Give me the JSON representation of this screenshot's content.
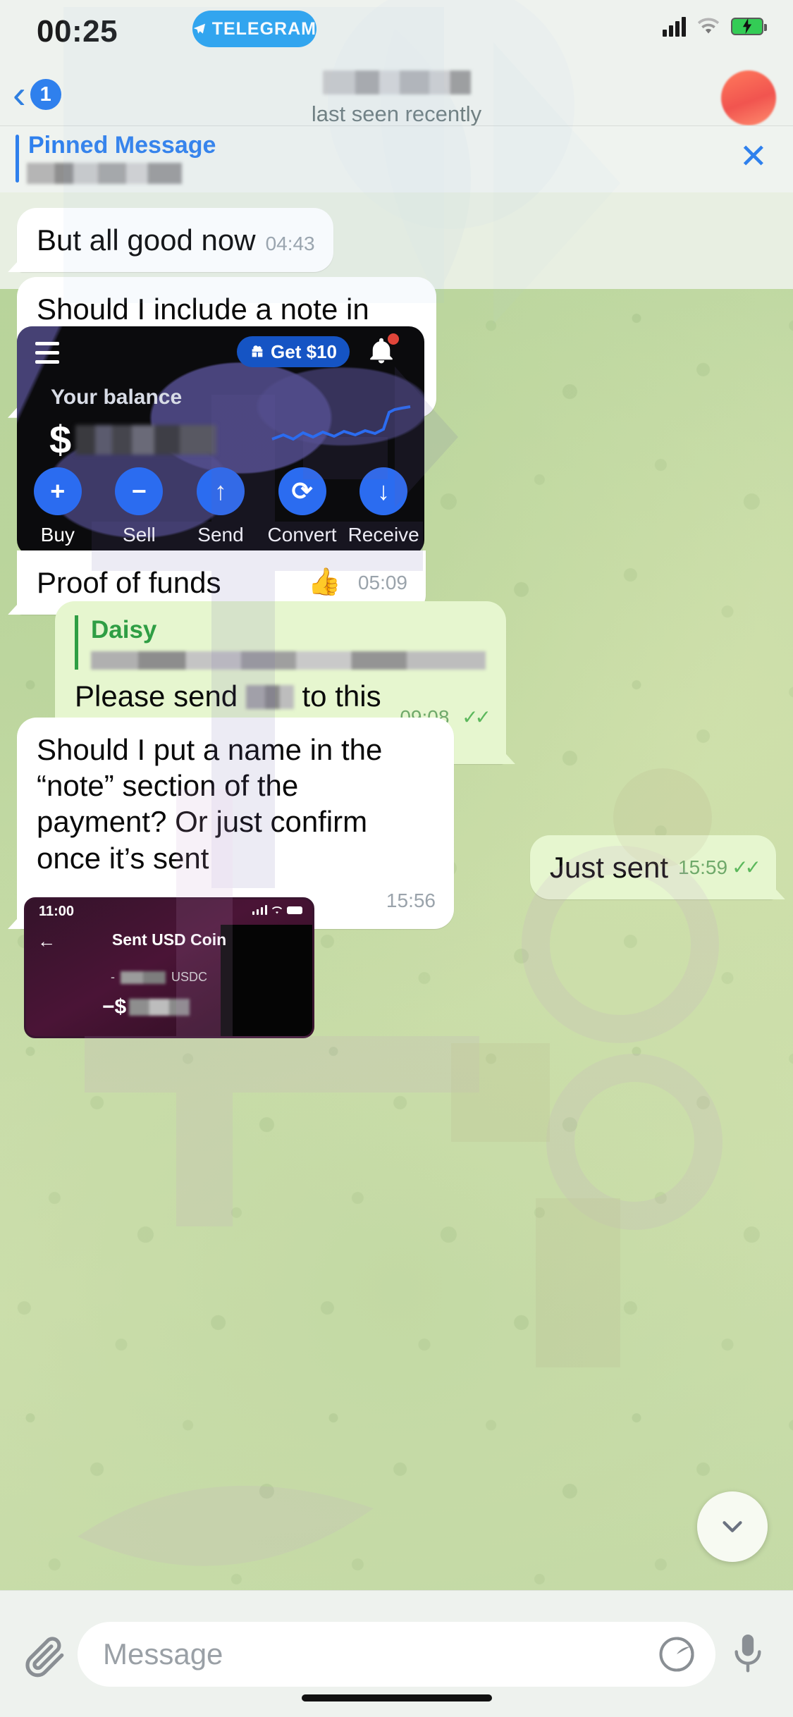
{
  "status_bar": {
    "time": "00:25",
    "app_badge": "TELEGRAM",
    "signal_icon": "signal-bars-icon",
    "wifi_icon": "wifi-icon",
    "battery_icon": "battery-charging-icon"
  },
  "nav": {
    "back_icon": "chevron-left-icon",
    "unread_count": "1",
    "peer_name": "",
    "peer_status": "last seen recently",
    "avatar_icon": "avatar"
  },
  "pinned": {
    "title": "Pinned Message",
    "preview": "",
    "close_icon": "close-icon"
  },
  "messages": [
    {
      "id": "m1",
      "side": "in",
      "text": "But all good now",
      "time": "04:43"
    },
    {
      "id": "m2",
      "side": "in",
      "text": "Should I include a note in the deposit?",
      "time": "05:09"
    },
    {
      "id": "m3",
      "side": "in",
      "type": "image",
      "caption": "Proof of funds",
      "reaction": "👍",
      "time": "05:09"
    },
    {
      "id": "m4",
      "side": "out",
      "type": "reply",
      "quote_name": "Daisy",
      "quote_preview": "",
      "text_before": "Please send",
      "text_after": "to this address",
      "time": "09:08",
      "status_icon": "double-check-icon"
    },
    {
      "id": "m5",
      "side": "in",
      "text": "Should I put a name in the “note” section of the payment? Or just confirm once it’s sent",
      "time": "15:56"
    },
    {
      "id": "m6",
      "side": "out",
      "text": "Just sent",
      "time": "15:59",
      "status_icon": "double-check-icon"
    }
  ],
  "crypto_card": {
    "menu_icon": "hamburger-menu-icon",
    "promo_label": "Get $10",
    "promo_icon": "gift-icon",
    "bell_icon": "bell-icon",
    "balance_label": "Your balance",
    "balance_currency": "$",
    "balance_value": "",
    "chart_icon": "sparkline-icon",
    "actions": [
      {
        "label": "Buy",
        "icon": "plus-icon"
      },
      {
        "label": "Sell",
        "icon": "minus-icon"
      },
      {
        "label": "Send",
        "icon": "arrow-up-icon"
      },
      {
        "label": "Convert",
        "icon": "convert-icon"
      },
      {
        "label": "Receive",
        "icon": "arrow-down-icon"
      }
    ]
  },
  "receipt_card": {
    "time": "11:00",
    "back_icon": "arrow-left-icon",
    "title": "Sent USD Coin",
    "amount_value": "",
    "amount_unit": "USDC",
    "total_prefix": "−$",
    "total_value": ""
  },
  "scroll_fab": {
    "icon": "chevron-down-icon"
  },
  "composer": {
    "attach_icon": "paperclip-icon",
    "placeholder": "Message",
    "value": "",
    "sticker_icon": "sticker-icon",
    "mic_icon": "microphone-icon"
  },
  "colors": {
    "accent": "#2f80ed",
    "bubble_out": "#e6f6cf",
    "bubble_in": "#ffffff",
    "check": "#5cb85c",
    "quote": "#2f9e44"
  }
}
